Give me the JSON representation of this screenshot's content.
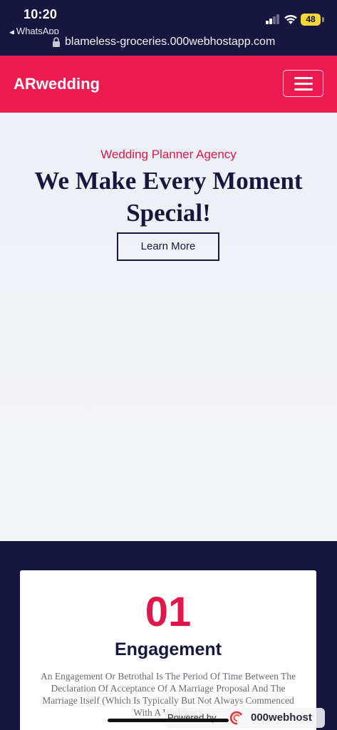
{
  "status_bar": {
    "time": "10:20",
    "back_app": "WhatsApp",
    "battery": "48",
    "battery_color": "#f5d63b"
  },
  "browser": {
    "url": "blameless-groceries.000webhostapp.com"
  },
  "navbar": {
    "brand": "ARwedding",
    "menu_icon": "hamburger-icon",
    "color": "#ed1b4f"
  },
  "hero": {
    "subtitle": "Wedding Planner Agency",
    "title": "We Make Every Moment Special!",
    "button_label": "Learn More"
  },
  "services": {
    "cards": [
      {
        "number": "01",
        "title": "Engagement",
        "description": "An Engagement Or Betrothal Is The Period Of Time Between The Declaration Of Acceptance Of A Marriage Proposal And The Marriage Itself (Which Is Typically But Not Always Commenced With A Wedding)."
      }
    ]
  },
  "badge": {
    "powered_by": "Powered by",
    "host": "000webhost"
  },
  "colors": {
    "navy": "#171640",
    "accent": "#e0174a"
  }
}
